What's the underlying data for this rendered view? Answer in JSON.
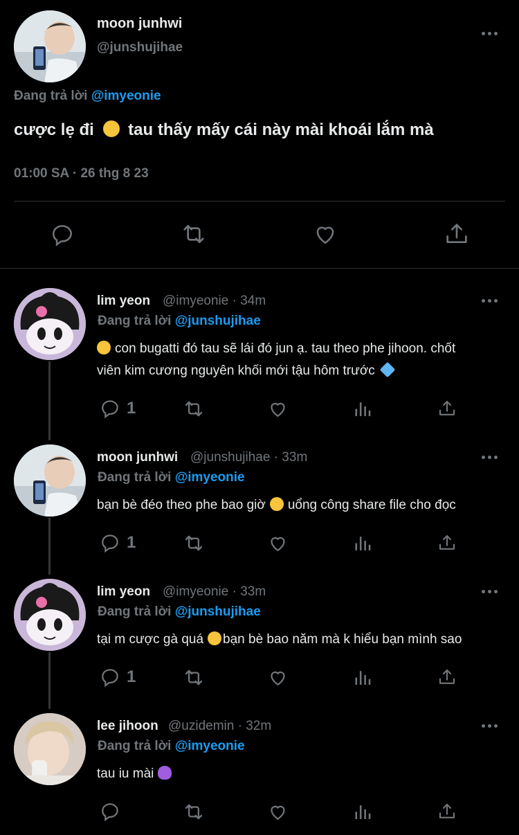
{
  "main_tweet": {
    "display_name": "moon junhwi",
    "handle": "@junshujihae",
    "replying_prefix": "Đang trả lời",
    "replying_to": "@imyeonie",
    "text_before": "cược lẹ đi",
    "emoji": "smiling-face-with-hearts",
    "text_after": "tau thấy mấy cái này mài khoái lắm mà",
    "timestamp": "01:00 SA · 26 thg 8 23",
    "actions": [
      "reply",
      "retweet",
      "like",
      "share"
    ]
  },
  "replies": [
    {
      "display_name": "lim yeon",
      "handle_line": "@imyeonie · 34m",
      "avatar": "kuromi",
      "replying_prefix": "Đang trả lời",
      "replying_to": "@junshujihae",
      "line1_emoji": "heart-eyes",
      "line1": "con bugatti đó tau sẽ lái đó jun ạ. tau theo phe jihoon. chốt",
      "line2": "viên kim cương nguyên khối mới tậu hôm trước",
      "line2_emoji": "gem",
      "reply_count": "1"
    },
    {
      "display_name": "moon junhwi",
      "handle_line": "@junshujihae · 33m",
      "avatar": "photo",
      "replying_prefix": "Đang trả lời",
      "replying_to": "@imyeonie",
      "line1_before": "bạn bè đéo theo phe bao giờ",
      "line1_emoji": "smiling-face-with-hearts",
      "line1_after": "uổng công share file cho đọc",
      "reply_count": "1"
    },
    {
      "display_name": "lim yeon",
      "handle_line": "@imyeonie · 33m",
      "avatar": "kuromi",
      "replying_prefix": "Đang trả lời",
      "replying_to": "@junshujihae",
      "line1_before": "tại m cược gà quá",
      "line1_emoji": "smiling-face-with-hearts",
      "line1_after": "bạn bè bao năm mà k hiểu bạn mình sao",
      "reply_count": "1"
    },
    {
      "display_name": "lee jihoon",
      "handle_line": "@uzidemin · 32m",
      "avatar": "photo",
      "replying_prefix": "Đang trả lời",
      "replying_to": "@imyeonie",
      "line1_before": "tau iu mài",
      "line1_emoji": "purple-heart",
      "reply_count": ""
    }
  ],
  "colors": {
    "background": "#000000",
    "text": "#e7e9ea",
    "muted": "#71767b",
    "link": "#1d9bf0",
    "divider": "#2f3336"
  }
}
